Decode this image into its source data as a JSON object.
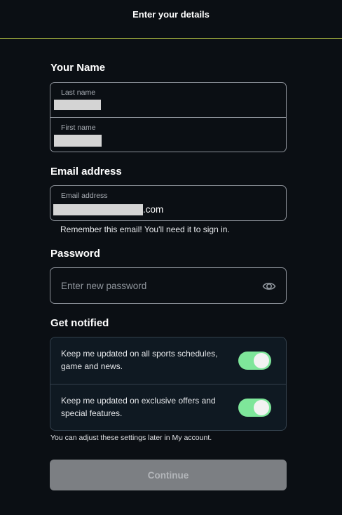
{
  "header": {
    "title": "Enter your details"
  },
  "name_section": {
    "heading": "Your Name",
    "last_name_label": "Last name",
    "first_name_label": "First name"
  },
  "email_section": {
    "heading": "Email address",
    "field_label": "Email address",
    "value_suffix": ".com",
    "hint": "Remember this email! You'll need it to sign in."
  },
  "password_section": {
    "heading": "Password",
    "placeholder": "Enter new password",
    "visibility_icon": "eye-icon"
  },
  "notify_section": {
    "heading": "Get notified",
    "items": [
      {
        "text": "Keep me updated on all sports schedules, game and news.",
        "enabled": true
      },
      {
        "text": "Keep me updated on exclusive offers and special features.",
        "enabled": true
      }
    ],
    "footnote": "You can adjust these settings later in My account."
  },
  "continue_button": {
    "label": "Continue",
    "disabled": true
  },
  "colors": {
    "background": "#0b0f14",
    "header_accent_line": "#c8d94a",
    "toggle_on": "#7ee69a",
    "button_disabled": "#7c7f83"
  }
}
